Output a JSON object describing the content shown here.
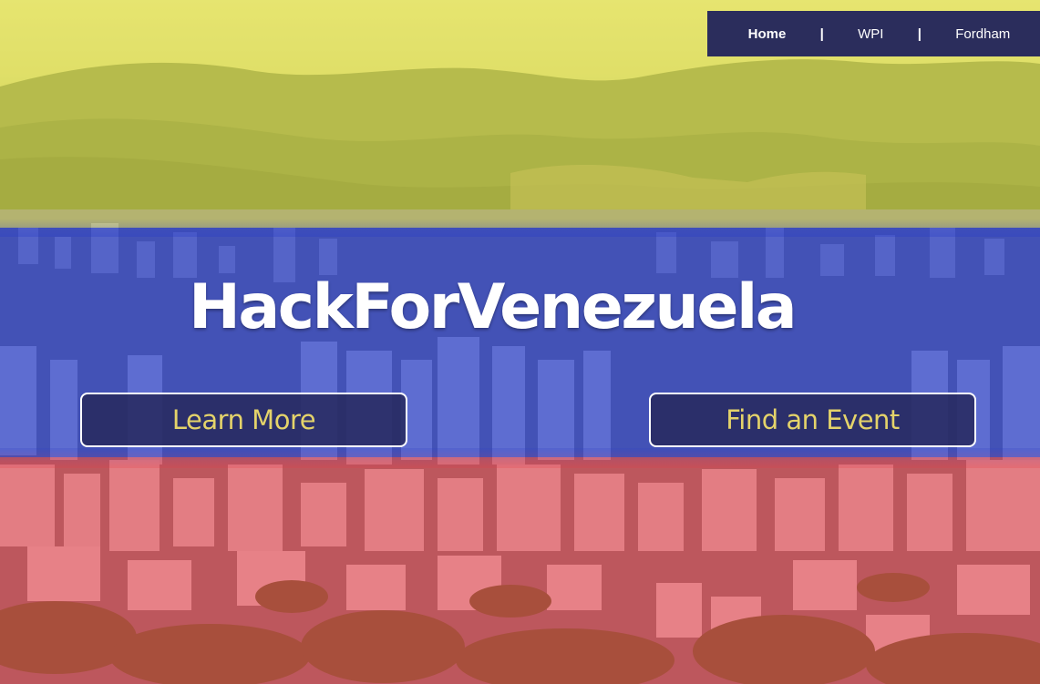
{
  "nav": {
    "items": [
      {
        "label": "Home",
        "active": true
      },
      {
        "label": "WPI",
        "active": false
      },
      {
        "label": "Fordham",
        "active": false
      }
    ],
    "separator": "|"
  },
  "hero": {
    "title": "HackForVenezuela",
    "buttons": {
      "learn_more": "Learn More",
      "find_event": "Find an Event"
    }
  },
  "colors": {
    "nav_bg": "#2b2d5c",
    "button_bg": "#282a60",
    "button_text": "#e4d36a",
    "flag_yellow": "#e6e450",
    "flag_blue": "#1830d2",
    "flag_red": "#ec2834"
  }
}
